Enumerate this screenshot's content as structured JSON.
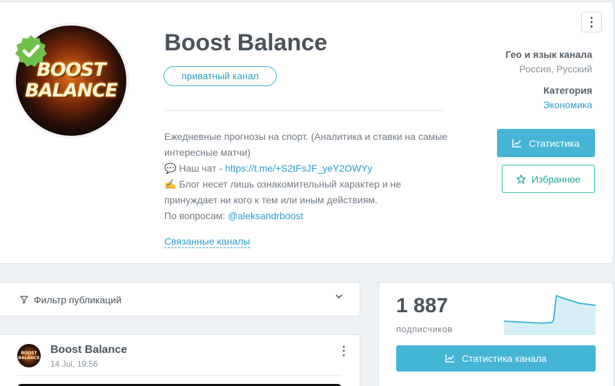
{
  "channel": {
    "title": "Boost Balance",
    "avatar_text": [
      "BOOST",
      "BALANCE"
    ],
    "badge": "приватный канал",
    "description": {
      "line1": "Ежедневные прогнозы на спорт. (Аналитика и ставки на самые интересные матчи)",
      "chat_prefix": "Наш чат - ",
      "chat_link": "https://t.me/+S2tFsJF_yeY2OWYy",
      "blog_text": "Блог несет лишь ознакомительный характер и не принуждает ни кого к тем или иным действиям.",
      "contact_prefix": "По вопросам: ",
      "contact_link": "@aleksandrboost"
    },
    "related_link": "Связанные каналы",
    "more_menu": "⋮"
  },
  "meta": {
    "geo_label": "Гео и язык канала",
    "geo_value": "Россия, Русский",
    "category_label": "Категория",
    "category_value": "Экономика"
  },
  "buttons": {
    "stats": "Статистика",
    "favorite": "Избранное",
    "channel_stats": "Статистика канала"
  },
  "filter": {
    "label": "Фильтр публикаций"
  },
  "post": {
    "author": "Boost Balance",
    "date": "14 Jul, 19:56"
  },
  "subscribers": {
    "count": "1 887",
    "label": "подписчиков"
  },
  "colors": {
    "accent": "#45b5d6",
    "link": "#2a9fcf",
    "favorite": "#2ebfa8",
    "verified": "#6fc04a"
  },
  "icons": {
    "stats": "chart-line-icon",
    "favorite": "star-outline-icon",
    "filter": "funnel-icon",
    "chevron": "chevron-down-icon",
    "verified": "verified-badge-icon",
    "chat": "speech-bubble-emoji",
    "writing": "writing-hand-emoji"
  }
}
